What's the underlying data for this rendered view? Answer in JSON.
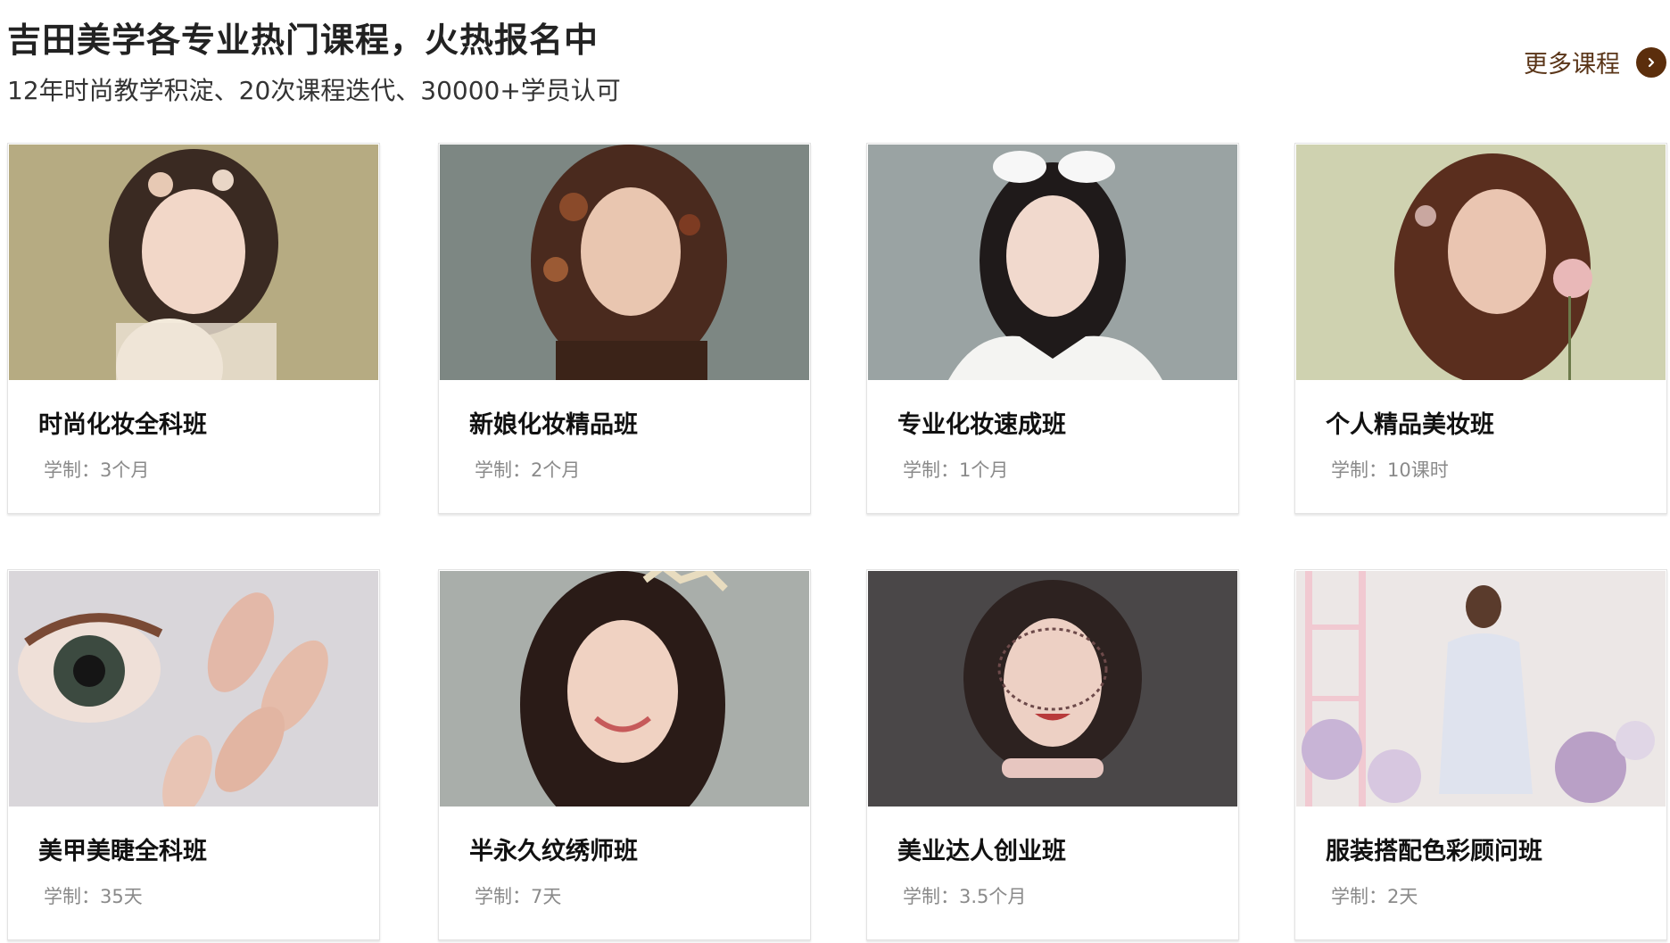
{
  "section": {
    "title": "吉田美学各专业热门课程，火热报名中",
    "subtitle": "12年时尚教学积淀、20次课程迭代、30000+学员认可",
    "more_label": "更多课程",
    "more_icon": "chevron-right-icon",
    "accent_color": "#5b2e0c"
  },
  "courses": [
    {
      "name": "时尚化妆全科班",
      "duration": "学制：3个月",
      "bg": "#b6ab82"
    },
    {
      "name": "新娘化妆精品班",
      "duration": "学制：2个月",
      "bg": "#7d8783"
    },
    {
      "name": "专业化妆速成班",
      "duration": "学制：1个月",
      "bg": "#9aa3a3"
    },
    {
      "name": "个人精品美妆班",
      "duration": "学制：10课时",
      "bg": "#cfd2b0"
    },
    {
      "name": "美甲美睫全科班",
      "duration": "学制：35天",
      "bg": "#d9d6da"
    },
    {
      "name": "半永久纹绣师班",
      "duration": "学制：7天",
      "bg": "#a9aeaa"
    },
    {
      "name": "美业达人创业班",
      "duration": "学制：3.5个月",
      "bg": "#4a4748"
    },
    {
      "name": "服装搭配色彩顾问班",
      "duration": "学制：2天",
      "bg": "#ece7e6"
    }
  ]
}
